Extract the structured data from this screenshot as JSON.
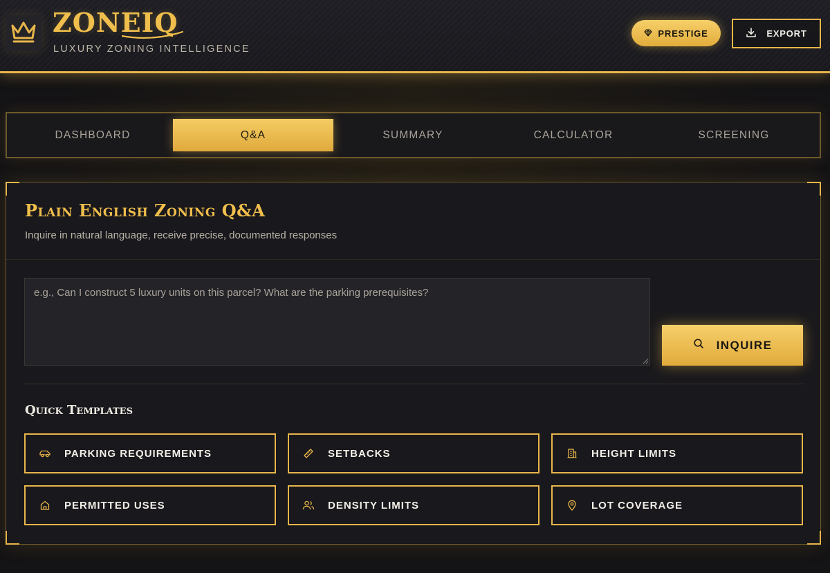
{
  "header": {
    "brand": "ZONEIQ",
    "tagline": "LUXURY ZONING INTELLIGENCE",
    "prestige_label": "PRESTIGE",
    "export_label": "EXPORT",
    "logo_icon": "crown-icon"
  },
  "tabs": [
    {
      "label": "DASHBOARD",
      "active": false
    },
    {
      "label": "Q&A",
      "active": true
    },
    {
      "label": "SUMMARY",
      "active": false
    },
    {
      "label": "CALCULATOR",
      "active": false
    },
    {
      "label": "SCREENING",
      "active": false
    }
  ],
  "panel": {
    "title": "Plain English Zoning Q&A",
    "subtitle": "Inquire in natural language, receive precise, documented responses",
    "query_placeholder": "e.g., Can I construct 5 luxury units on this parcel? What are the parking prerequisites?",
    "query_value": "",
    "inquire_label": "INQUIRE",
    "templates_title": "Quick Templates",
    "templates": [
      {
        "label": "PARKING REQUIREMENTS",
        "icon": "car-icon"
      },
      {
        "label": "SETBACKS",
        "icon": "ruler-icon"
      },
      {
        "label": "HEIGHT LIMITS",
        "icon": "building-icon"
      },
      {
        "label": "PERMITTED USES",
        "icon": "home-icon"
      },
      {
        "label": "DENSITY LIMITS",
        "icon": "users-icon"
      },
      {
        "label": "LOT COVERAGE",
        "icon": "map-pin-icon"
      }
    ]
  },
  "colors": {
    "accent_gold": "#e8b64a",
    "background": "#141315",
    "panel": "#19181c"
  }
}
